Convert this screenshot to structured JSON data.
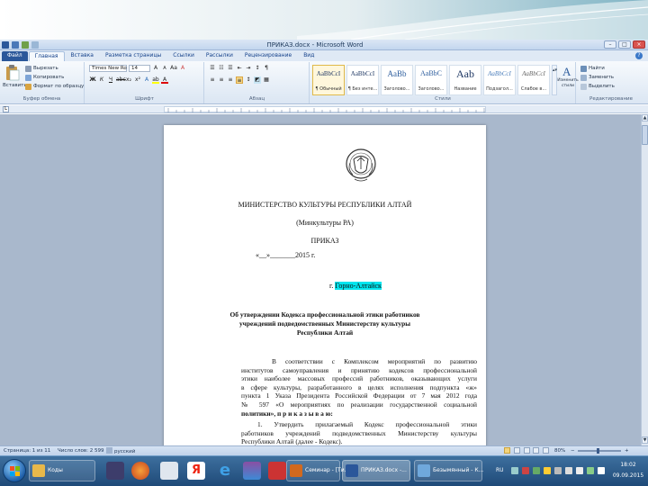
{
  "window": {
    "title": "ПРИКАЗ.docx - Microsoft Word"
  },
  "tabs": [
    "Файл",
    "Главная",
    "Вставка",
    "Разметка страницы",
    "Ссылки",
    "Рассылки",
    "Рецензирование",
    "Вид"
  ],
  "ribbon": {
    "clipboard": {
      "paste": "Вставить",
      "cut": "Вырезать",
      "copy": "Копировать",
      "format_painter": "Формат по образцу",
      "label": "Буфер обмена"
    },
    "font": {
      "name": "Times New Ro",
      "size": "14",
      "label": "Шрифт"
    },
    "paragraph": {
      "label": "Абзац"
    },
    "styles": {
      "label": "Стили",
      "items": [
        {
          "sample": "AaBbCcI",
          "name": "¶ Обычный"
        },
        {
          "sample": "AaBbCcI",
          "name": "¶ Без инте..."
        },
        {
          "sample": "AaBb",
          "name": "Заголово..."
        },
        {
          "sample": "AaBbC",
          "name": "Заголово..."
        },
        {
          "sample": "Aab",
          "name": "Название"
        },
        {
          "sample": "AaBbCcI",
          "name": "Подзагол..."
        },
        {
          "sample": "AaBbCcI",
          "name": "Слабое в..."
        }
      ],
      "change_styles": "Изменить стили"
    },
    "editing": {
      "find": "Найти",
      "replace": "Заменить",
      "select": "Выделить",
      "label": "Редактирование"
    }
  },
  "ruler": {
    "corner": "L"
  },
  "document": {
    "ministry": "МИНИСТЕРСТВО КУЛЬТУРЫ РЕСПУБЛИКИ АЛТАЙ",
    "ministry_short": "(Минкультуры РА)",
    "order_title": "ПРИКАЗ",
    "date_line": "«__»_______2015 г.",
    "city_prefix": "г.",
    "city": "Горно-Алтайск",
    "subject_lines": [
      "Об утверждении Кодекса профессиональной этики работников",
      "учреждений подведомственных Министерству культуры",
      "Республики Алтай"
    ],
    "body_lines": [
      "В соответствии с Комплексом мероприятий по развитию",
      "институтов самоуправления и принятию кодексов профессиональной",
      "этики наиболее массовых профессий работников, оказывающих услуги",
      "в сфере культуры, разработанного в целях исполнения подпункта «ж»",
      "пункта 1 Указа Президента Российской Федерации от 7 мая 2012 года",
      "№ 597 «О мероприятиях по реализации государственной социальной",
      "политики», п р и к а з ы в а ю:"
    ],
    "item1_lines": [
      "1. Утвердить прилагаемый Кодекс профессиональной этики",
      "работников учреждений подведомственных Министерству культуры",
      "Республики Алтай (далее - Кодекс)."
    ]
  },
  "statusbar": {
    "page": "Страница: 1 из 11",
    "words": "Число слов: 2 599",
    "language": "русский",
    "zoom": "80%",
    "zoom_level": 0.45
  },
  "taskbar": {
    "windows": [
      {
        "label": "Коды"
      },
      {
        "label": "Семинар - [Ти..."
      },
      {
        "label": "ПРИКАЗ.docx -..."
      },
      {
        "label": "Безымянный - К..."
      }
    ],
    "lang": "RU",
    "time": "18:02",
    "date": "09.09.2015"
  },
  "colors": {
    "highlight": "#00e5ee",
    "file_tab": "#2b579a",
    "taskbar": "#1f4a78"
  }
}
